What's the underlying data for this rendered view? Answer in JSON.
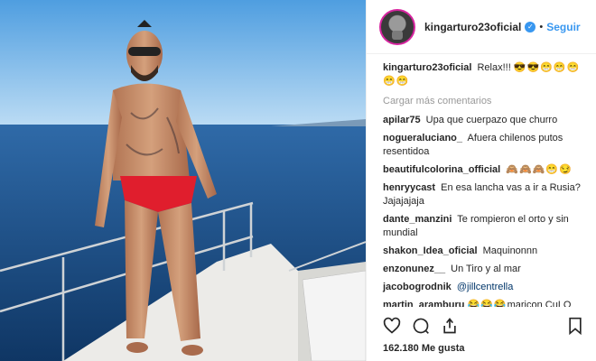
{
  "post": {
    "username": "kingarturo23oficial",
    "follow_label": "Seguir",
    "caption": "Relax!!!",
    "caption_emoji": "😎😎😁😁😁😁😁"
  },
  "load_more": "Cargar más comentarios",
  "comments": [
    {
      "user": "apilar75",
      "text": "Upa que cuerpazo que churro"
    },
    {
      "user": "nogueraluciano_",
      "text": "Afuera chilenos putos resentidoa"
    },
    {
      "user": "beautifulcolorina_official",
      "text": "🙈🙈🙈😁😏"
    },
    {
      "user": "henryycast",
      "text": "En esa lancha vas a ir a Rusia? Jajajajaja"
    },
    {
      "user": "dante_manzini",
      "text": "Te rompieron el orto y sin mundial"
    },
    {
      "user": "shakon_Idea_oficial",
      "text": "Maquinonnn"
    },
    {
      "user": "enzonunez__",
      "text": "Un Tiro y al mar"
    },
    {
      "user": "jacobogrodnik",
      "text": "@jillcentrella"
    },
    {
      "user": "martin_aramburu",
      "emoji": "😂😂😂",
      "text": "maricon CuLO roto!! La peor generación del Perú"
    }
  ],
  "likes": "162.180 Me gusta",
  "icons": [
    "heart-icon",
    "comment-icon",
    "share-icon",
    "bookmark-icon",
    "verified-icon"
  ],
  "colors": {
    "link": "#3897f0",
    "text": "#262626",
    "muted": "#999999",
    "sky": "#8cc4ec",
    "sea": "#1d4f85"
  }
}
